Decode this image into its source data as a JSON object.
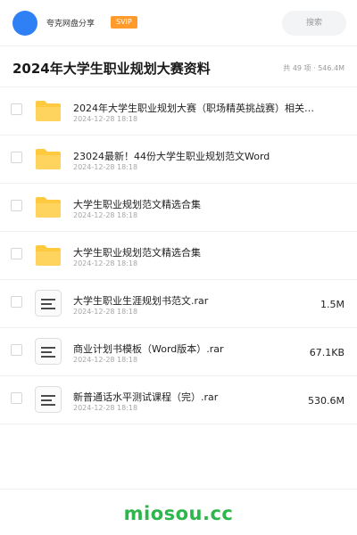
{
  "header": {
    "username": "夸克网盘分享",
    "badge": "SVIP",
    "search_label": "搜索"
  },
  "folder": {
    "title": "2024年大学生职业规划大赛资料",
    "meta": "共 49 项 · 546.4M"
  },
  "files": [
    {
      "icon": "folder-icon",
      "name": "2024年大学生职业规划大赛（职场精英挑战赛）相关…",
      "date": "2024-12-28 18:18",
      "size": ""
    },
    {
      "icon": "folder-icon",
      "name": "23024最新！44份大学生职业规划范文Word",
      "date": "2024-12-28 18:18",
      "size": ""
    },
    {
      "icon": "folder-icon",
      "name": "大学生职业规划范文精选合集",
      "date": "2024-12-28 18:18",
      "size": ""
    },
    {
      "icon": "folder-icon",
      "name": "大学生职业规划范文精选合集",
      "date": "2024-12-28 18:18",
      "size": ""
    },
    {
      "icon": "document-icon",
      "name": "大学生职业生涯规划书范文.rar",
      "date": "2024-12-28 18:18",
      "size": "1.5M"
    },
    {
      "icon": "document-icon",
      "name": "商业计划书模板（Word版本）.rar",
      "date": "2024-12-28 18:18",
      "size": "67.1KB"
    },
    {
      "icon": "document-icon",
      "name": "新普通话水平测试课程（完）.rar",
      "date": "2024-12-28 18:18",
      "size": "530.6M"
    }
  ],
  "footer": {
    "brand": "miosou.cc"
  },
  "colors": {
    "avatar": "#2f7ff5",
    "svip": "#ff9a2b",
    "folder": "#ffc940",
    "brand": "#2cb64b"
  }
}
